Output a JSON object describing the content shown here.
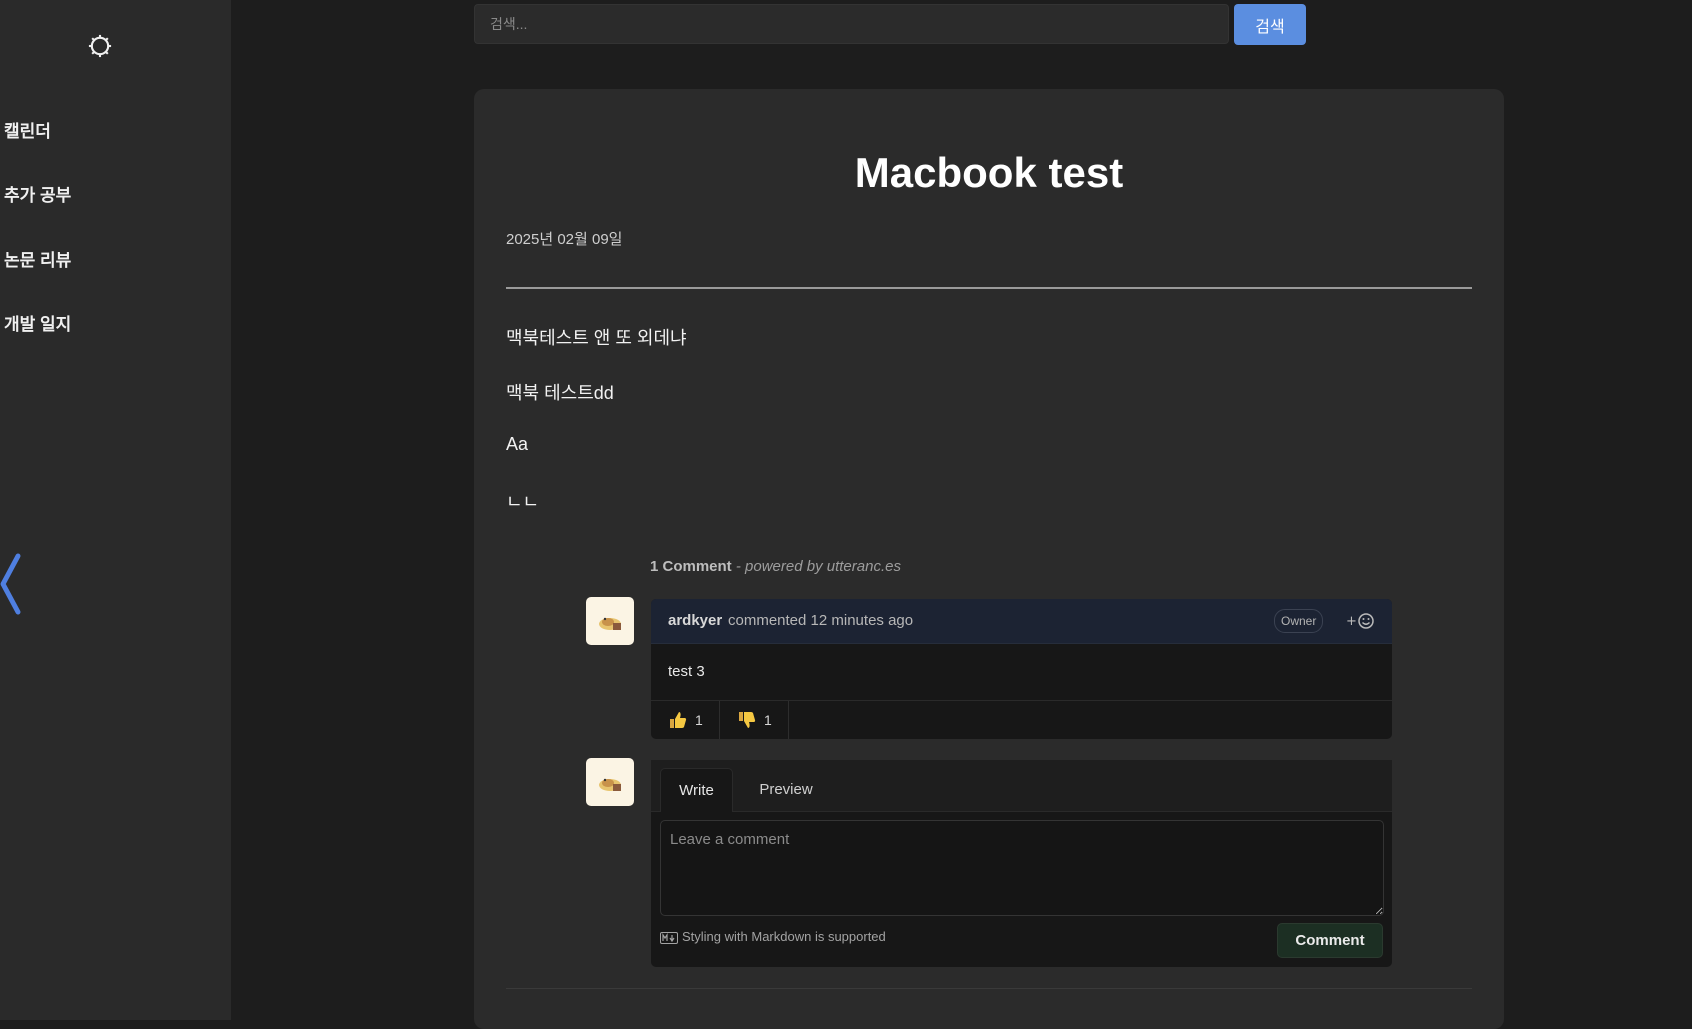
{
  "sidebar": {
    "settings_icon": "gear-icon",
    "items": [
      {
        "label": "캘린더"
      },
      {
        "label": "추가 공부"
      },
      {
        "label": "논문 리뷰"
      },
      {
        "label": "개발 일지"
      }
    ],
    "collapse_icon": "chevron-left-icon"
  },
  "search": {
    "placeholder": "검색...",
    "value": "",
    "button_label": "검색"
  },
  "post": {
    "title": "Macbook test",
    "date": "2025년 02월 09일",
    "body": [
      "맥북테스트 앤 또 외데냐",
      "맥북 테스트dd",
      "Aa",
      "ㄴㄴ"
    ]
  },
  "comments": {
    "count_label": "1 Comment",
    "powered_by": "- powered by utteranc.es",
    "items": [
      {
        "author": "ardkyer",
        "meta": "commented 12 minutes ago",
        "badge": "Owner",
        "body": "test 3",
        "reactions": [
          {
            "icon": "thumbs-up-icon",
            "count": "1"
          },
          {
            "icon": "thumbs-down-icon",
            "count": "1"
          }
        ]
      }
    ],
    "add_reaction_icon": "add-reaction-icon",
    "editor": {
      "tab_write": "Write",
      "tab_preview": "Preview",
      "placeholder": "Leave a comment",
      "value": "",
      "markdown_hint": "Styling with Markdown is supported",
      "submit_label": "Comment"
    }
  },
  "colors": {
    "background": "#1d1d1d",
    "sidebar": "#2a2a2a",
    "card": "#2b2b2b",
    "accent": "#5b8ee0",
    "comment_header": "#1c2333",
    "comment_button": "#1c2f23"
  }
}
